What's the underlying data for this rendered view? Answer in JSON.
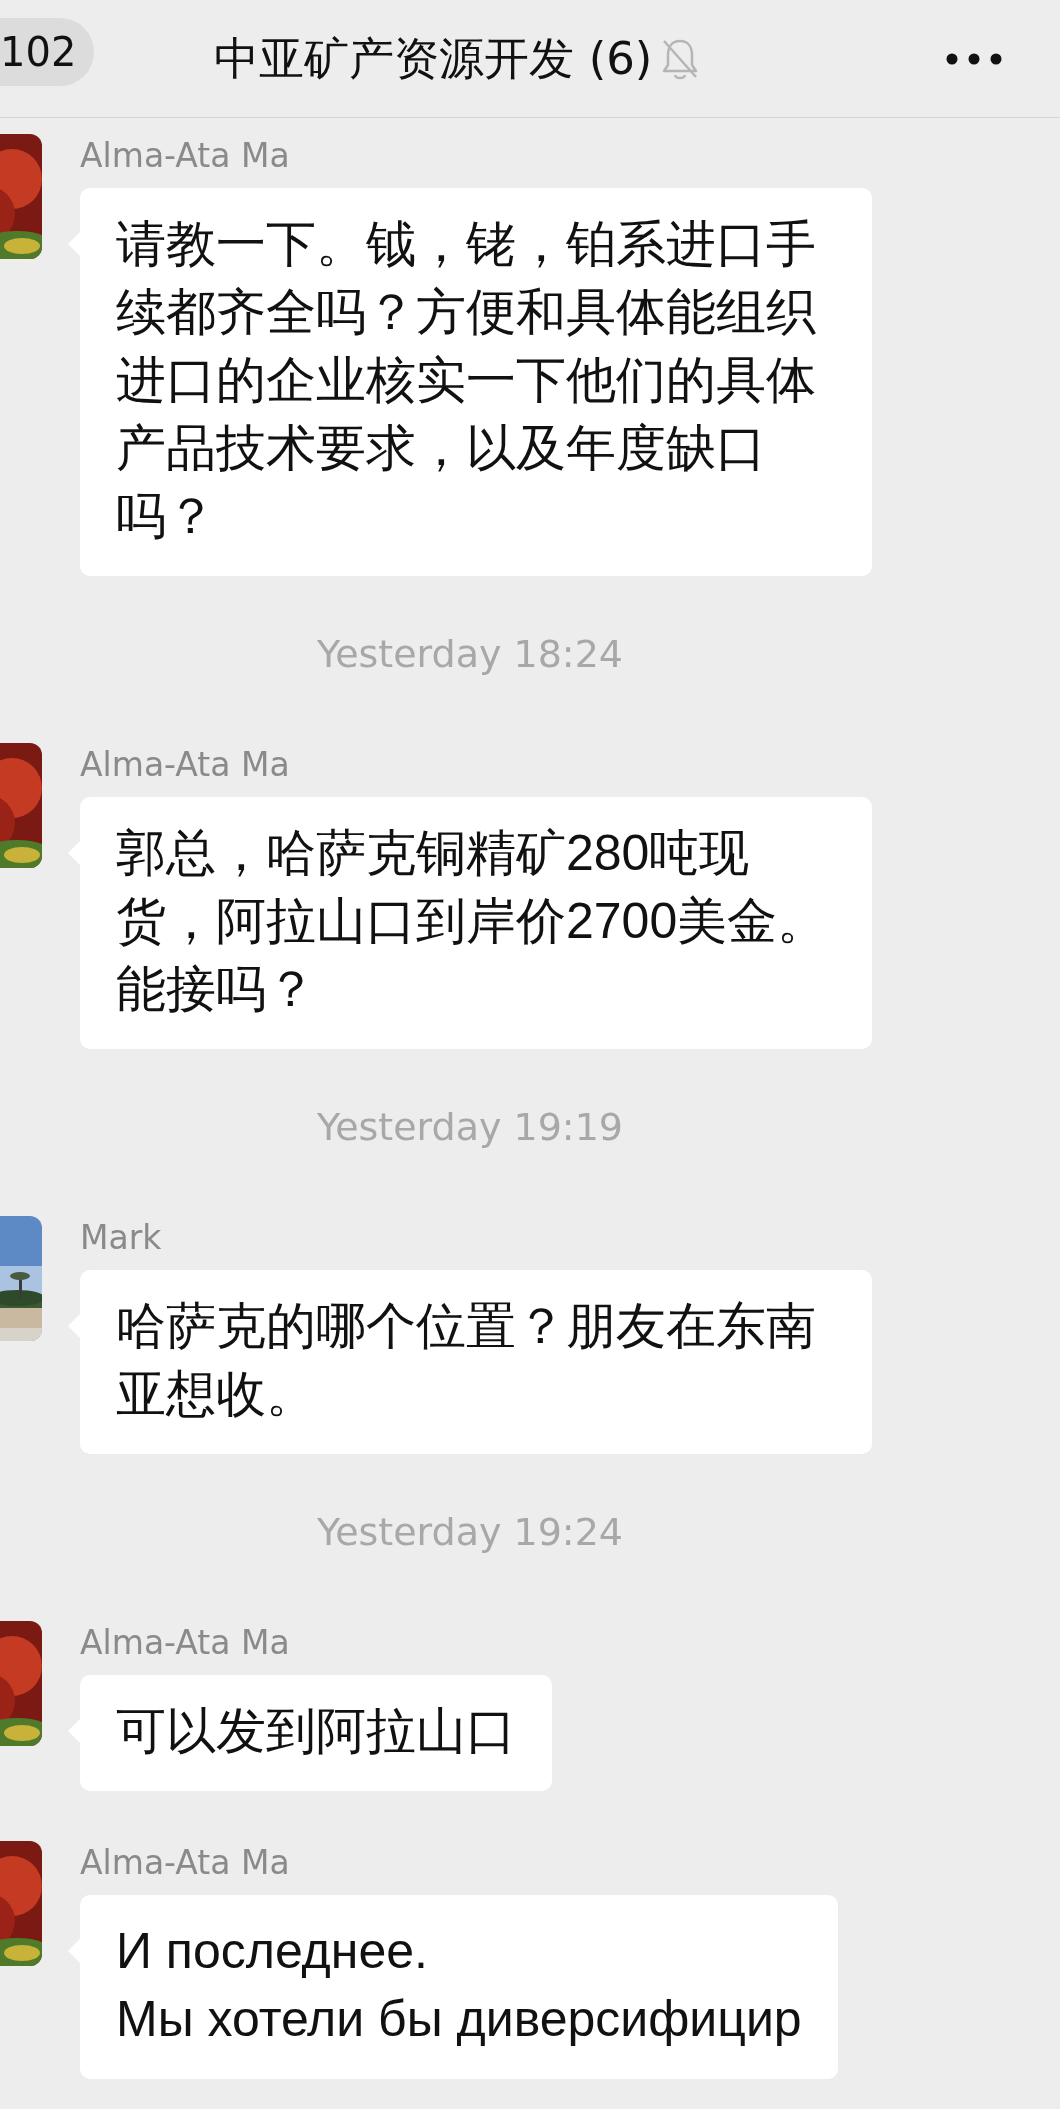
{
  "header": {
    "back_count": "102",
    "title": "中亚矿产资源开发 (6)",
    "muted": true
  },
  "messages": [
    {
      "kind": "message",
      "sender": "Alma-Ata Ma",
      "text": "请教一下。钺，铑，铂系进口手续都齐全吗？方便和具体能组织进口的企业核实一下他们的具体产品技术要求，以及年度缺口吗？"
    },
    {
      "kind": "time",
      "text": "Yesterday 18:24"
    },
    {
      "kind": "message",
      "sender": "Alma-Ata Ma",
      "text": "郭总，哈萨克铜精矿280吨现货，阿拉山口到岸价2700美金。能接吗？"
    },
    {
      "kind": "time",
      "text": "Yesterday 19:19"
    },
    {
      "kind": "message",
      "sender": "Mark",
      "text": "哈萨克的哪个位置？朋友在东南亚想收。"
    },
    {
      "kind": "time",
      "text": "Yesterday 19:24"
    },
    {
      "kind": "message",
      "sender": "Alma-Ata Ma",
      "text": "可以发到阿拉山口"
    },
    {
      "kind": "message",
      "sender": "Alma-Ata Ma",
      "text": "И последнее.\nМы хотели бы диверсифицир"
    }
  ]
}
